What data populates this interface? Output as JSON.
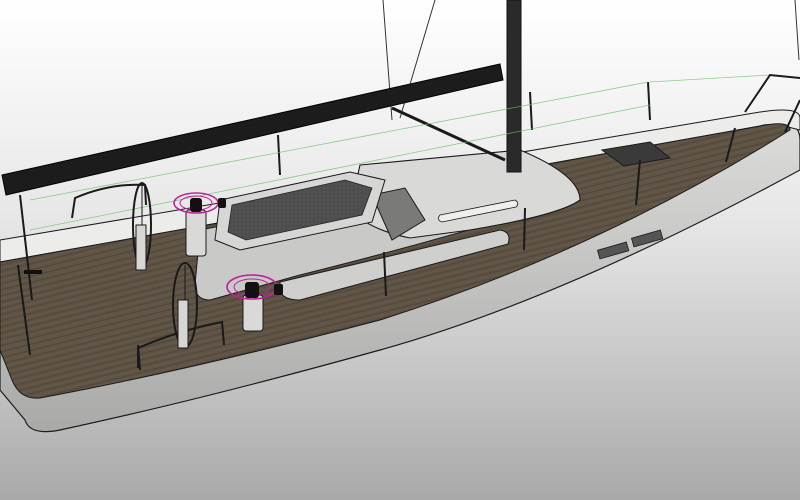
{
  "viewport": {
    "background_top": "#ffffff",
    "background_bottom": "#a9a9a9"
  },
  "colors": {
    "hull": "#d6d6d4",
    "hull_shadow": "#bdbdbb",
    "deck_wood": "#5e5344",
    "deck_wood_light": "#776a58",
    "cabin": "#cfcfcd",
    "boom": "#1c1c1c",
    "mast": "#2a2a2a",
    "outline": "#1a1a1a",
    "selection_magenta": "#c0209a",
    "guide_green": "#6fc46f"
  },
  "scene": {
    "subject": "sailboat-3d-model",
    "has_rails": true,
    "has_helm_wheels": 2,
    "has_winches": 2
  }
}
